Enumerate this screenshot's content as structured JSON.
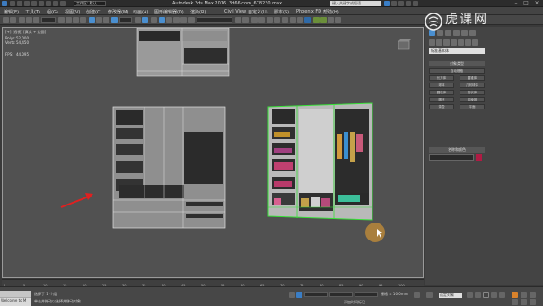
{
  "window": {
    "app_title": "Autodesk 3ds Max 2016",
    "file_title": "3d66.com_678230.max",
    "workspace": "工作区: 默认",
    "search_placeholder": "键入关键字或短语"
  },
  "menu": [
    "编辑(E)",
    "工具(T)",
    "组(G)",
    "视图(V)",
    "创建(C)",
    "修改器(M)",
    "动画(A)",
    "图形编辑器(D)",
    "渲染(R)",
    "Civil View",
    "自定义(U)",
    "脚本(S)",
    "Phoenix FD",
    "帮助(H)"
  ],
  "viewport": {
    "label": "[+] [透视] [真实 + 边面]",
    "stats": [
      {
        "name": "总计",
        "value": "Polys:",
        "num": "52,000"
      },
      {
        "name": "Verts:",
        "num": "54,450"
      },
      {
        "name": "FPS:",
        "num": "44.095"
      }
    ]
  },
  "command_panel": {
    "object_type_header": "对象类型",
    "object_name_field": "",
    "name_color_header": "名称和颜色",
    "object_type_buttons": [
      "对象类型",
      "自动栅格",
      "长方体",
      "圆锥体",
      "球体",
      "几何球体",
      "圆柱体",
      "管状体",
      "圆环",
      "四棱锥",
      "茶壶",
      "平面"
    ],
    "accent_color": "#b01b44"
  },
  "timeline": {
    "ticks": [
      "0",
      "5",
      "10",
      "15",
      "20",
      "25",
      "30",
      "35",
      "40",
      "45",
      "50",
      "55",
      "60",
      "65",
      "70",
      "75",
      "80",
      "85",
      "90",
      "95",
      "100"
    ]
  },
  "status": {
    "line1": "选择了 1 个组",
    "line2": "单击并拖动以选择并移动对象",
    "thumb_label": "Welcome to M",
    "grid": "栅格 = 10.0mm",
    "key_mode": "选定对象",
    "add_time_tag": "添加时间标记"
  },
  "watermark": {
    "text": "虎课网"
  }
}
